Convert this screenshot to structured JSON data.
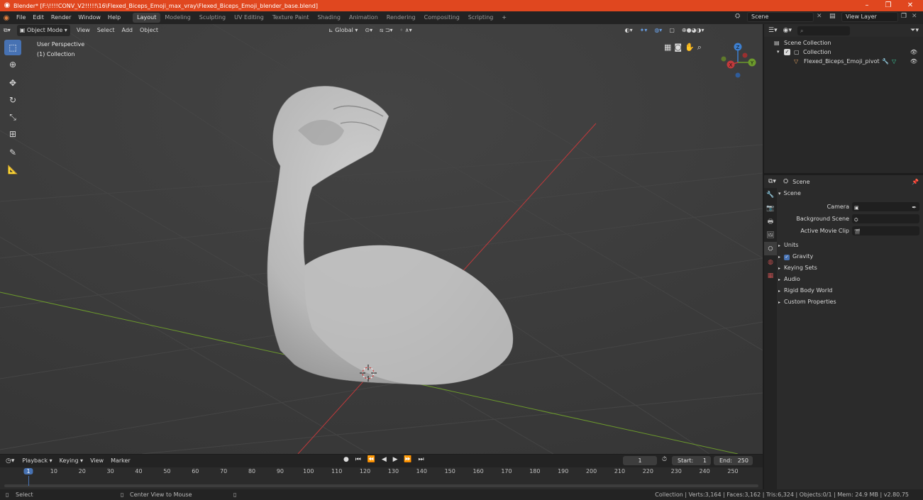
{
  "titlebar": {
    "title": "Blender* [F:\\!!!!CONV_V2!!!!!\\16\\Flexed_Biceps_Emoji_max_vray\\Flexed_Biceps_Emoji_blender_base.blend]",
    "minimize": "–",
    "maximize": "❐",
    "close": "✕"
  },
  "menu": [
    "File",
    "Edit",
    "Render",
    "Window",
    "Help"
  ],
  "workspaces": [
    "Layout",
    "Modeling",
    "Sculpting",
    "UV Editing",
    "Texture Paint",
    "Shading",
    "Animation",
    "Rendering",
    "Compositing",
    "Scripting"
  ],
  "scene_name": "Scene",
  "view_layer": "View Layer",
  "viewport": {
    "mode": "Object Mode",
    "menus": [
      "View",
      "Select",
      "Add",
      "Object"
    ],
    "transform_orientation": "Global",
    "perspective_label": "User Perspective",
    "collection_label": "(1) Collection",
    "gizmo_axes": {
      "x": "X",
      "y": "Y",
      "z": "Z"
    }
  },
  "tools": [
    "select-box-icon",
    "cursor-icon",
    "move-icon",
    "rotate-icon",
    "scale-icon",
    "transform-icon",
    "annotate-icon",
    "measure-icon"
  ],
  "outliner": {
    "scene_collection": "Scene Collection",
    "collection": "Collection",
    "object": "Flexed_Biceps_Emoji_pivot"
  },
  "properties": {
    "header": "Scene",
    "panel_title": "Scene",
    "camera_label": "Camera",
    "background_scene_label": "Background Scene",
    "active_movie_clip_label": "Active Movie Clip",
    "sections": [
      "Units",
      "Gravity",
      "Keying Sets",
      "Audio",
      "Rigid Body World",
      "Custom Properties"
    ]
  },
  "timeline": {
    "menus": [
      "Playback",
      "Keying",
      "View",
      "Marker"
    ],
    "current_frame": "1",
    "start_label": "Start:",
    "start": "1",
    "end_label": "End:",
    "end": "250",
    "frame_ticks": [
      "1",
      "10",
      "20",
      "30",
      "40",
      "50",
      "60",
      "70",
      "80",
      "90",
      "100",
      "110",
      "120",
      "130",
      "140",
      "150",
      "160",
      "170",
      "180",
      "190",
      "200",
      "210",
      "220",
      "230",
      "240",
      "250"
    ],
    "current_frame_marker": "1"
  },
  "status": {
    "select": "Select",
    "center_view": "Center View to Mouse",
    "stats": "Collection | Verts:3,164 | Faces:3,162 | Tris:6,324 | Objects:0/1 | Mem: 24.9 MB | v2.80.75"
  },
  "colors": {
    "title_bar": "#e0471f",
    "accent": "#4772b3",
    "viewport_bg": "#3a3a3a",
    "x_axis": "#c0393b",
    "y_axis": "#6c9a2c",
    "z_axis": "#3d7fcf"
  }
}
